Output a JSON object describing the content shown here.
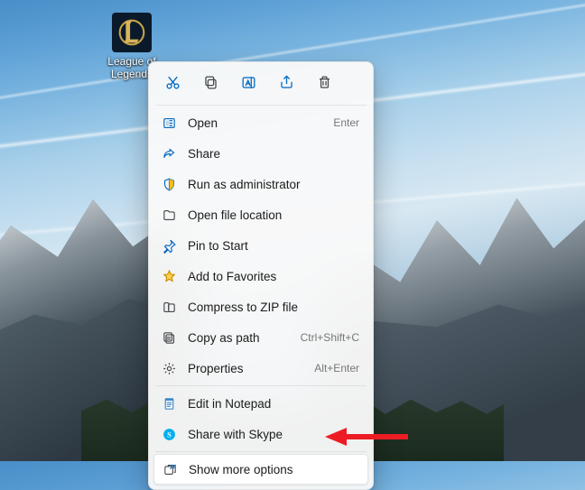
{
  "desktop": {
    "icon_label": "League of Legends"
  },
  "toolbar": [
    {
      "name": "cut-icon"
    },
    {
      "name": "copy-icon"
    },
    {
      "name": "rename-icon"
    },
    {
      "name": "share-icon"
    },
    {
      "name": "delete-icon"
    }
  ],
  "menu": {
    "items": [
      {
        "icon": "open-icon",
        "label": "Open",
        "accel": "Enter"
      },
      {
        "icon": "share-arrow-icon",
        "label": "Share",
        "accel": ""
      },
      {
        "icon": "shield-icon",
        "label": "Run as administrator",
        "accel": ""
      },
      {
        "icon": "folder-icon",
        "label": "Open file location",
        "accel": ""
      },
      {
        "icon": "pin-icon",
        "label": "Pin to Start",
        "accel": ""
      },
      {
        "icon": "star-icon",
        "label": "Add to Favorites",
        "accel": ""
      },
      {
        "icon": "zip-icon",
        "label": "Compress to ZIP file",
        "accel": ""
      },
      {
        "icon": "copy-path-icon",
        "label": "Copy as path",
        "accel": "Ctrl+Shift+C"
      },
      {
        "icon": "properties-icon",
        "label": "Properties",
        "accel": "Alt+Enter"
      }
    ],
    "extra": [
      {
        "icon": "notepad-icon",
        "label": "Edit in Notepad"
      },
      {
        "icon": "skype-icon",
        "label": "Share with Skype"
      }
    ],
    "more": {
      "icon": "more-icon",
      "label": "Show more options"
    }
  },
  "colors": {
    "accent_blue": "#0067c0",
    "star_gold": "#f7b500",
    "skype_blue": "#00aff0",
    "arrow_red": "#ed1c24"
  }
}
